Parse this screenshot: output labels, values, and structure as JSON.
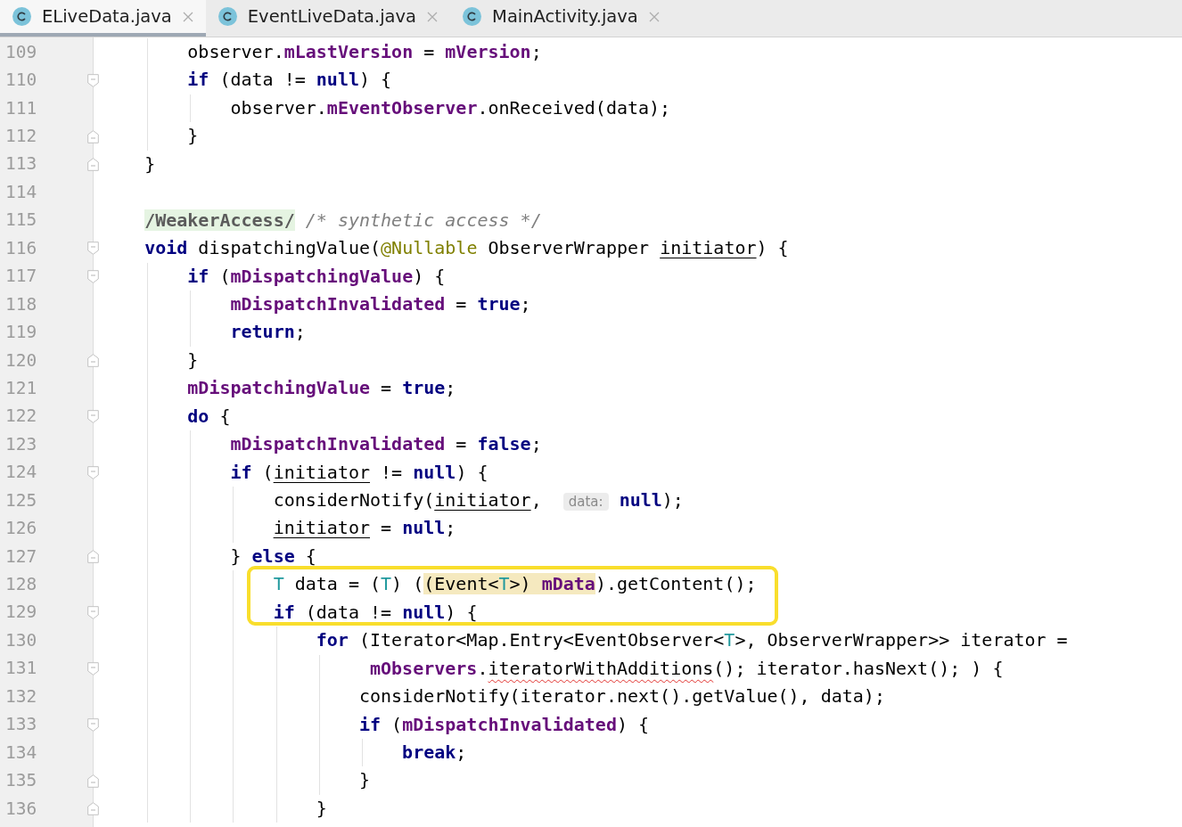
{
  "tabs": [
    {
      "title": "ELiveData.java",
      "selected": true
    },
    {
      "title": "EventLiveData.java",
      "selected": false
    },
    {
      "title": "MainActivity.java",
      "selected": false
    }
  ],
  "editor": {
    "lines": [
      {
        "children": [
          {
            "number": "109",
            "tokens": [
              {
                "kind": "plain",
                "text": "observer."
              },
              {
                "kind": "field",
                "text": "mLastVersion"
              },
              {
                "kind": "plain",
                "text": " = "
              },
              {
                "kind": "field",
                "text": "mVersion"
              },
              {
                "kind": "plain",
                "text": ";"
              }
            ]
          },
          {
            "number": "110",
            "fold_start": true,
            "tokens": [
              {
                "kind": "keyword",
                "text": "if"
              },
              {
                "kind": "plain",
                "text": " (data != "
              },
              {
                "kind": "keyword",
                "text": "null"
              },
              {
                "kind": "plain",
                "text": ") {"
              }
            ],
            "children": [
              {
                "number": "111",
                "tokens": [
                  {
                    "kind": "plain",
                    "text": "observer."
                  },
                  {
                    "kind": "field",
                    "text": "mEventObserver"
                  },
                  {
                    "kind": "plain",
                    "text": ".onReceived(data);"
                  }
                ]
              }
            ]
          },
          {
            "number": "112",
            "fold_end": true,
            "tokens": [
              {
                "kind": "plain",
                "text": "}"
              }
            ]
          }
        ]
      },
      {
        "number": "113",
        "fold_end": true,
        "tokens": [
          {
            "kind": "plain",
            "text": "}"
          }
        ]
      },
      {
        "number": "114"
      },
      {
        "number": "115",
        "tokens": [
          {
            "kind": "folded",
            "text": "/WeakerAccess/"
          },
          {
            "kind": "comment",
            "text": " /* synthetic access */"
          }
        ]
      },
      {
        "number": "116",
        "fold_start": true,
        "tokens": [
          {
            "kind": "keyword",
            "text": "void"
          },
          {
            "kind": "plain",
            "text": " dispatchingValue("
          },
          {
            "kind": "annotation",
            "text": "@Nullable"
          },
          {
            "kind": "plain",
            "text": " ObserverWrapper "
          },
          {
            "kind": "parameter",
            "text": "initiator"
          },
          {
            "kind": "plain",
            "text": ") {"
          }
        ],
        "children": [
          {
            "number": "117",
            "fold_start": true,
            "tokens": [
              {
                "kind": "keyword",
                "text": "if"
              },
              {
                "kind": "plain",
                "text": " ("
              },
              {
                "kind": "field",
                "text": "mDispatchingValue"
              },
              {
                "kind": "plain",
                "text": ") {"
              }
            ],
            "children": [
              {
                "number": "118",
                "tokens": [
                  {
                    "kind": "field",
                    "text": "mDispatchInvalidated"
                  },
                  {
                    "kind": "plain",
                    "text": " = "
                  },
                  {
                    "kind": "keyword",
                    "text": "true"
                  },
                  {
                    "kind": "plain",
                    "text": ";"
                  }
                ]
              },
              {
                "number": "119",
                "tokens": [
                  {
                    "kind": "keyword",
                    "text": "return"
                  },
                  {
                    "kind": "plain",
                    "text": ";"
                  }
                ]
              }
            ]
          },
          {
            "number": "120",
            "fold_end": true,
            "tokens": [
              {
                "kind": "plain",
                "text": "}"
              }
            ]
          },
          {
            "number": "121",
            "tokens": [
              {
                "kind": "field",
                "text": "mDispatchingValue"
              },
              {
                "kind": "plain",
                "text": " = "
              },
              {
                "kind": "keyword",
                "text": "true"
              },
              {
                "kind": "plain",
                "text": ";"
              }
            ]
          },
          {
            "number": "122",
            "fold_start": true,
            "tokens": [
              {
                "kind": "keyword",
                "text": "do"
              },
              {
                "kind": "plain",
                "text": " {"
              }
            ],
            "children": [
              {
                "number": "123",
                "tokens": [
                  {
                    "kind": "field",
                    "text": "mDispatchInvalidated"
                  },
                  {
                    "kind": "plain",
                    "text": " = "
                  },
                  {
                    "kind": "keyword",
                    "text": "false"
                  },
                  {
                    "kind": "plain",
                    "text": ";"
                  }
                ]
              },
              {
                "number": "124",
                "fold_start": true,
                "tokens": [
                  {
                    "kind": "keyword",
                    "text": "if"
                  },
                  {
                    "kind": "plain",
                    "text": " ("
                  },
                  {
                    "kind": "parameter",
                    "text": "initiator"
                  },
                  {
                    "kind": "plain",
                    "text": " != "
                  },
                  {
                    "kind": "keyword",
                    "text": "null"
                  },
                  {
                    "kind": "plain",
                    "text": ") {"
                  }
                ],
                "children": [
                  {
                    "number": "125",
                    "tokens": [
                      {
                        "kind": "plain",
                        "text": "considerNotify("
                      },
                      {
                        "kind": "parameter",
                        "text": "initiator"
                      },
                      {
                        "kind": "plain",
                        "text": ",  "
                      },
                      {
                        "kind": "hint",
                        "text": "data:"
                      },
                      {
                        "kind": "keyword",
                        "text": " null"
                      },
                      {
                        "kind": "plain",
                        "text": ");"
                      }
                    ]
                  },
                  {
                    "number": "126",
                    "tokens": [
                      {
                        "kind": "parameter",
                        "text": "initiator"
                      },
                      {
                        "kind": "plain",
                        "text": " = "
                      },
                      {
                        "kind": "keyword",
                        "text": "null"
                      },
                      {
                        "kind": "plain",
                        "text": ";"
                      }
                    ]
                  }
                ]
              },
              {
                "number": "127",
                "fold_end": true,
                "tokens": [
                  {
                    "kind": "plain",
                    "text": "} "
                  },
                  {
                    "kind": "keyword",
                    "text": "else"
                  },
                  {
                    "kind": "plain",
                    "text": " {"
                  }
                ],
                "children": [
                  {
                    "number": "128",
                    "framed": true,
                    "tokens": [
                      {
                        "kind": "type",
                        "text": "T"
                      },
                      {
                        "kind": "plain",
                        "text": " data = ("
                      },
                      {
                        "kind": "type",
                        "text": "T"
                      },
                      {
                        "kind": "plain",
                        "text": ") ("
                      },
                      {
                        "kind": "plain",
                        "text": "(Event<",
                        "highlighted": true
                      },
                      {
                        "kind": "type",
                        "text": "T",
                        "highlighted": true
                      },
                      {
                        "kind": "plain",
                        "text": ">) ",
                        "highlighted": true
                      },
                      {
                        "kind": "field",
                        "text": "mData",
                        "highlighted": true
                      },
                      {
                        "kind": "plain",
                        "text": ").getContent();"
                      }
                    ]
                  },
                  {
                    "number": "129",
                    "fold_start": true,
                    "framed": true,
                    "tokens": [
                      {
                        "kind": "keyword",
                        "text": "if"
                      },
                      {
                        "kind": "plain",
                        "text": " (data != "
                      },
                      {
                        "kind": "keyword",
                        "text": "null"
                      },
                      {
                        "kind": "plain",
                        "text": ") {"
                      }
                    ],
                    "children": [
                      {
                        "number": "130",
                        "tokens": [
                          {
                            "kind": "keyword",
                            "text": "for"
                          },
                          {
                            "kind": "plain",
                            "text": " (Iterator<Map.Entry<EventObserver<"
                          },
                          {
                            "kind": "type",
                            "text": "T"
                          },
                          {
                            "kind": "plain",
                            "text": ">, ObserverWrapper>> iterator ="
                          }
                        ],
                        "children": [
                          {
                            "number": "131",
                            "fold_start": true,
                            "tokens": [
                              {
                                "kind": "field",
                                "text": " mObservers"
                              },
                              {
                                "kind": "plain",
                                "text": "."
                              },
                              {
                                "kind": "error",
                                "text": "iteratorWithAdditions"
                              },
                              {
                                "kind": "plain",
                                "text": "(); iterator.hasNext(); ) {"
                              }
                            ]
                          },
                          {
                            "number": "132",
                            "tokens": [
                              {
                                "kind": "plain",
                                "text": "considerNotify(iterator.next().getValue(), data);"
                              }
                            ]
                          },
                          {
                            "number": "133",
                            "fold_start": true,
                            "tokens": [
                              {
                                "kind": "keyword",
                                "text": "if"
                              },
                              {
                                "kind": "plain",
                                "text": " ("
                              },
                              {
                                "kind": "field",
                                "text": "mDispatchInvalidated"
                              },
                              {
                                "kind": "plain",
                                "text": ") {"
                              }
                            ],
                            "children": [
                              {
                                "number": "134",
                                "tokens": [
                                  {
                                    "kind": "keyword",
                                    "text": "break"
                                  },
                                  {
                                    "kind": "plain",
                                    "text": ";"
                                  }
                                ]
                              }
                            ]
                          },
                          {
                            "number": "135",
                            "fold_end": true,
                            "tokens": [
                              {
                                "kind": "plain",
                                "text": "}"
                              }
                            ]
                          }
                        ]
                      },
                      {
                        "number": "136",
                        "fold_end": true,
                        "tokens": [
                          {
                            "kind": "plain",
                            "text": "}"
                          }
                        ]
                      }
                    ]
                  }
                ]
              }
            ]
          }
        ]
      }
    ]
  }
}
